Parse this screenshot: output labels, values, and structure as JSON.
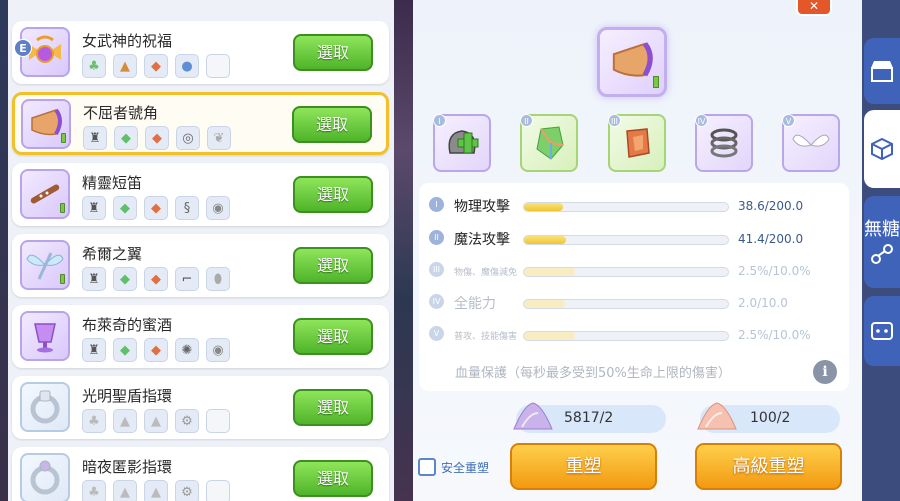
{
  "list": {
    "badge": "E",
    "select_label": "選取",
    "items": [
      {
        "name": "女武神的祝福",
        "mats": [
          "leaf",
          "cone",
          "stone",
          "gem",
          ""
        ],
        "selected": false
      },
      {
        "name": "不屈者號角",
        "mats": [
          "helm",
          "gem",
          "stone",
          "coil",
          "wing"
        ],
        "selected": true
      },
      {
        "name": "精靈短笛",
        "mats": [
          "helm",
          "gem",
          "stone",
          "coil",
          "ring"
        ],
        "selected": false
      },
      {
        "name": "希爾之翼",
        "mats": [
          "helm",
          "gem",
          "stone",
          "coil",
          "egg"
        ],
        "selected": false
      },
      {
        "name": "布萊奇的蜜酒",
        "mats": [
          "helm",
          "gem",
          "stone",
          "star",
          "ring"
        ],
        "selected": false
      },
      {
        "name": "光明聖盾指環",
        "mats": [
          "leaf",
          "cone",
          "cone",
          "coil",
          ""
        ],
        "selected": false
      },
      {
        "name": "暗夜匿影指環",
        "mats": [
          "leaf",
          "cone",
          "cone",
          "coil",
          ""
        ],
        "selected": false
      }
    ]
  },
  "detail": {
    "main_item_icon": "horn-icon",
    "slots": [
      {
        "num": "I",
        "icon": "armor-plus-icon",
        "style": "purple"
      },
      {
        "num": "II",
        "icon": "crystal-icon",
        "style": "green"
      },
      {
        "num": "III",
        "icon": "orange-stone-icon",
        "style": "green"
      },
      {
        "num": "IV",
        "icon": "coil-icon",
        "style": "purple"
      },
      {
        "num": "V",
        "icon": "wings-icon",
        "style": "purple"
      }
    ],
    "stats": [
      {
        "label": "物理攻擊",
        "value": "38.6/200.0",
        "fraction": 0.193,
        "active": true,
        "small": false
      },
      {
        "label": "魔法攻擊",
        "value": "41.4/200.0",
        "fraction": 0.207,
        "active": true,
        "small": false
      },
      {
        "label": "物傷、魔傷減免",
        "value": "2.5%/10.0%",
        "fraction": 0.25,
        "active": false,
        "small": true
      },
      {
        "label": "全能力",
        "value": "2.0/10.0",
        "fraction": 0.2,
        "active": false,
        "small": false
      },
      {
        "label": "普攻、技能傷害",
        "value": "2.5%/10.0%",
        "fraction": 0.25,
        "active": false,
        "small": true
      }
    ],
    "protect_text": "血量保護（每秒最多受到50%生命上限的傷害）",
    "info_label": "i",
    "cost_1": "5817/2",
    "cost_2": "100/2",
    "safe_label": "安全重塑",
    "reforge_label": "重塑",
    "advanced_reforge_label": "高級重塑"
  },
  "sidebar": {
    "text_tab": "無糖"
  }
}
